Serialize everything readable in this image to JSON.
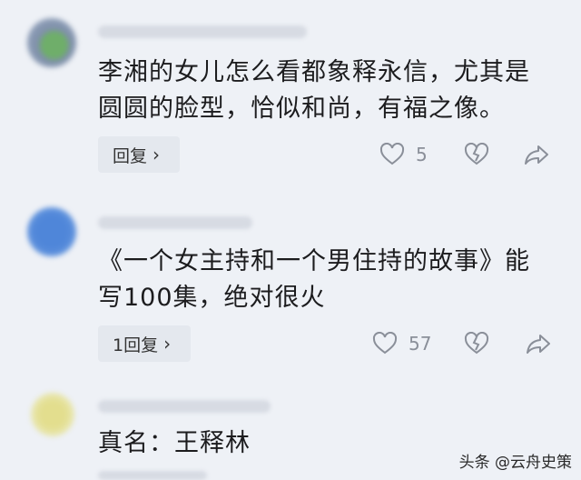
{
  "comments": [
    {
      "text_line1": "李湘的女儿怎么看都象释永信，尤其是",
      "text_line2": "圆圆的脸型，恰似和尚，有福之像。",
      "reply_label": "回复",
      "like_count": "5",
      "avatar_color": "#7e8fa8"
    },
    {
      "text_line1": "《一个女主持和一个男住持的故事》能",
      "text_line2": "写100集，绝对很火",
      "reply_label": "1回复",
      "like_count": "57",
      "avatar_color": "#4f86d9"
    },
    {
      "text_line1": "真名：王释林",
      "avatar_color": "#e3de8e"
    }
  ],
  "icons": {
    "like": "heart-icon",
    "dislike": "broken-heart-icon",
    "share": "share-arrow-icon",
    "chevron": "chevron-right-icon"
  },
  "watermark": "头条 @云舟史策"
}
